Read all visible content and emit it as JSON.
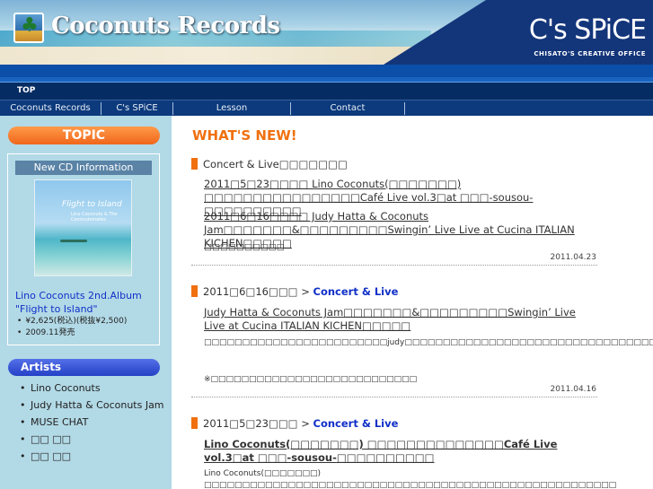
{
  "header": {
    "logo_text": "Coconuts Records",
    "brand": "C's SPiCE",
    "brand_sub": "CHISATO'S CREATIVE OFFICE"
  },
  "nav": {
    "top": "TOP",
    "items": [
      "Coconuts Records",
      "C's SPiCE",
      "Lesson",
      "Contact"
    ]
  },
  "sidebar": {
    "topic": "TOPIC",
    "cd_head": "New CD Information",
    "cd_cover_title": "Flight to Island",
    "cd_cover_sub": "Lino Coconuts & The Coconutsmates",
    "cd_title": "Lino Coconuts 2nd.Album \"Flight to Island\"",
    "cd_info": [
      "¥2,625(税込)(税抜¥2,500)",
      "2009.11発売"
    ],
    "artists": "Artists",
    "artist_list": [
      "Lino Coconuts",
      "Judy Hatta & Coconuts Jam",
      "MUSE CHAT",
      "□□ □□",
      "□□ □□"
    ]
  },
  "main": {
    "whatsnew": "WHAT'S NEW!",
    "sections": [
      {
        "head_prefix": "Concert & Live□□□□□□□",
        "lines": [
          "2011□5□23□□□□ Lino Coconuts(□□□□□□□) □□□□□□□□□□□□□□□□Café Live vol.3□at □□□-sousou-□□□□□□□□□□",
          "2011□6□16□□□□ Judy Hatta & Coconuts Jam□□□□□□□&□□□□□□□□□Swingin’ Live Live at Cucina ITALIAN KICHEN□□□□□",
          "□□□□□□□□□□"
        ],
        "date": "2011.04.23"
      },
      {
        "head_prefix": "2011□6□16□□□ > ",
        "head_link": "Concert & Live",
        "title": "Judy Hatta & Coconuts Jam□□□□□□□&□□□□□□□□□Swingin’ Live Live at Cucina ITALIAN KICHEN□□□□□",
        "body": "□□□□□□□□□□□□□□□□□□□□□□□□judy□□□□□□□□□□□□□□□□□□□□□□□□□□□□□□□□□□□",
        "note": "※□□□□□□□□□□□□□□□□□□□□□□□□□□□",
        "date": "2011.04.16"
      },
      {
        "head_prefix": "2011□5□23□□□ > ",
        "head_link": "Concert & Live",
        "title": "Lino Coconuts(□□□□□□□) □□□□□□□□□□□□□□Café Live vol.3□at □□□-sousou-□□□□□□□□□□",
        "body": "Lino Coconuts(□□□□□□□) □□□□□□□□□□□□□□□□□□□□□□□□□□□□□□□□□□□□□□□□□□□□□□□□□□□□□□"
      }
    ]
  }
}
